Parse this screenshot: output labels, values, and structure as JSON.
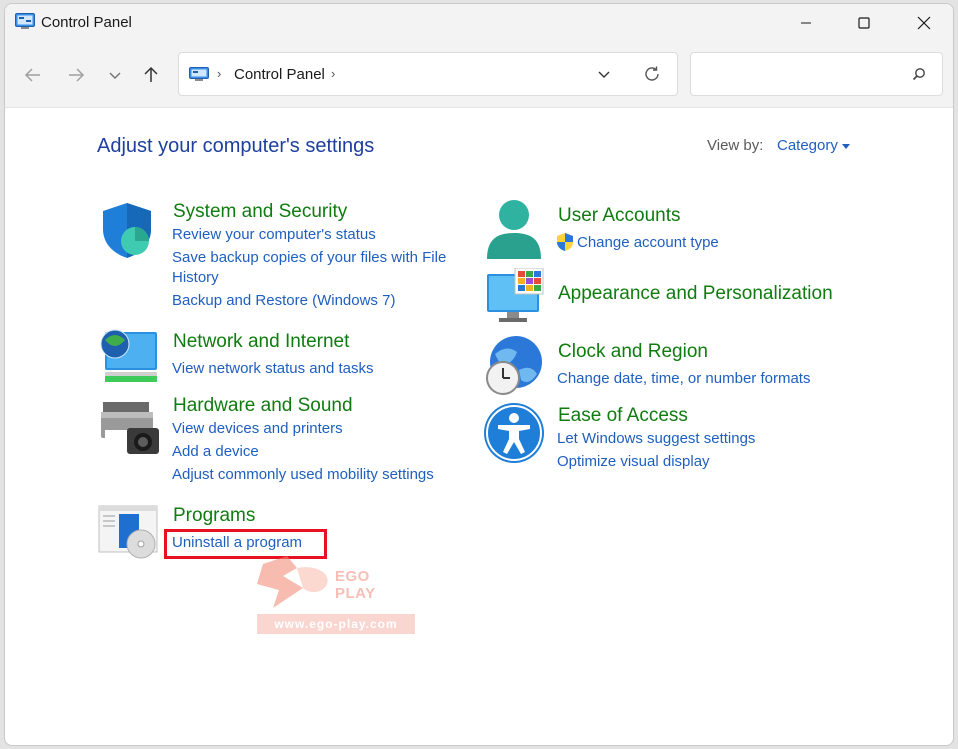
{
  "window": {
    "title": "Control Panel"
  },
  "address": {
    "segment": "Control Panel"
  },
  "search": {
    "placeholder": "",
    "value": ""
  },
  "heading": "Adjust your computer's settings",
  "view_by": {
    "label": "View by:",
    "value": "Category"
  },
  "categories": {
    "system": {
      "title": "System and Security",
      "links": [
        "Review your computer's status",
        "Save backup copies of your files with File",
        "History",
        "Backup and Restore (Windows 7)"
      ]
    },
    "network": {
      "title": "Network and Internet",
      "links": [
        "View network status and tasks"
      ]
    },
    "hardware": {
      "title": "Hardware and Sound",
      "links": [
        "View devices and printers",
        "Add a device",
        "Adjust commonly used mobility settings"
      ]
    },
    "programs": {
      "title": "Programs",
      "links": [
        "Uninstall a program"
      ]
    },
    "users": {
      "title": "User Accounts",
      "links": [
        "Change account type"
      ]
    },
    "appearance": {
      "title": "Appearance and Personalization",
      "links": []
    },
    "clock": {
      "title": "Clock and Region",
      "links": [
        "Change date, time, or number formats"
      ]
    },
    "ease": {
      "title": "Ease of Access",
      "links": [
        "Let Windows suggest settings",
        "Optimize visual display"
      ]
    }
  },
  "watermark": {
    "brand": "EGO PLAY",
    "url": "www.ego-play.com"
  },
  "colors": {
    "heading": "#1e3f9e",
    "category_title": "#107c10",
    "link": "#1f5fbf",
    "highlight": "#e81123"
  }
}
